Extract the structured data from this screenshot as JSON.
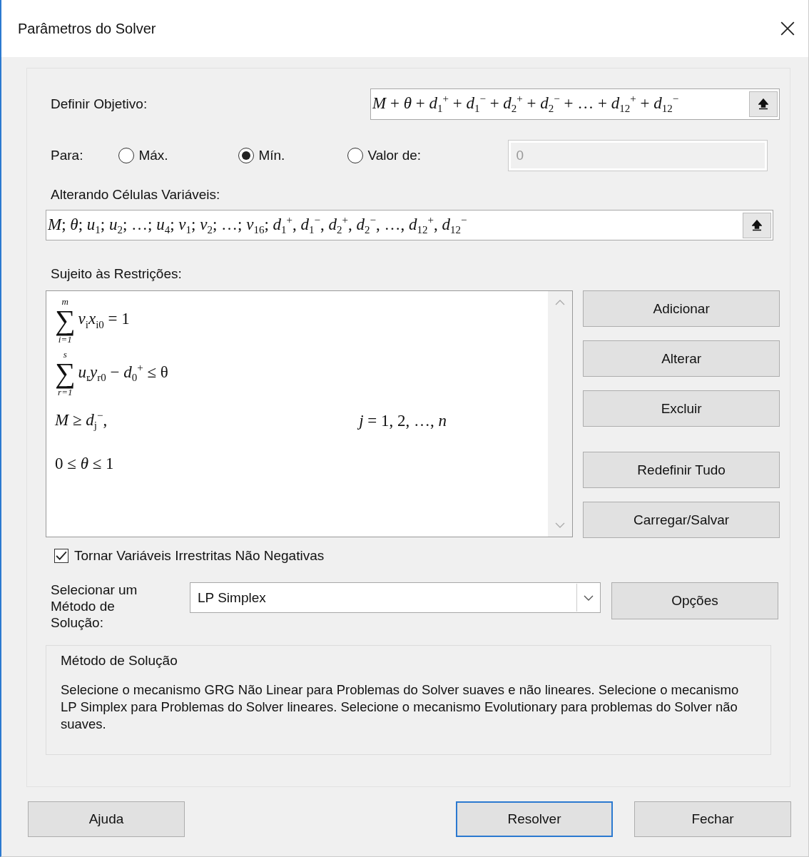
{
  "window": {
    "title": "Parâmetros do Solver"
  },
  "objective": {
    "label": "Definir Objetivo:",
    "value": "*M* + *θ* + *d*$_{1}$$^{+}$ + *d*$_{1}$$^{−}$ + *d*$_{2}$$^{+}$ + *d*$_{2}$$^{−}$ + … + *d*$_{12}$$^{+}$ + *d*$_{12}$$^{−}$"
  },
  "to": {
    "label": "Para:",
    "options": [
      {
        "label": "Máx.",
        "selected": false
      },
      {
        "label": "Mín.",
        "selected": true
      },
      {
        "label": "Valor de:",
        "selected": false
      }
    ],
    "value": "0",
    "disabled": true
  },
  "changing_cells": {
    "label": "Alterando Células Variáveis:",
    "value": "*M*; *θ*; *u*$_{1}$; *u*$_{2}$; …; *u*$_{4}$; *v*$_{1}$; *v*$_{2}$; …; *v*$_{16}$; *d*$_{1}$$^{+}$, *d*$_{1}$$^{−}$, *d*$_{2}$$^{+}$, *d*$_{2}$$^{−}$, …, *d*$_{12}$$^{+}$, *d*$_{12}$$^{−}$"
  },
  "constraints": {
    "label": "Sujeito às Restrições:",
    "items": [
      {
        "kind": "sum",
        "symbol": "∑",
        "upper": "m",
        "lower": "i=1",
        "body": "*v*$_{i}$*x*$_{i0}$ = 1"
      },
      {
        "kind": "sum",
        "symbol": "∑",
        "upper": "s",
        "lower": "r=1",
        "body": "*u*$_{r}$*y*$_{r0}$ − *d*$_{0}$$^{+}$ ≤ θ"
      },
      {
        "kind": "plain",
        "body": "*M* ≥ *d*$_{j}$$^{−}$,",
        "condition": "*j* = 1, 2, …, *n*"
      },
      {
        "kind": "plain",
        "body": "0 ≤ *θ* ≤ 1"
      }
    ]
  },
  "side_buttons": [
    "Adicionar",
    "Alterar",
    "Excluir",
    "Redefinir Tudo",
    "Carregar/Salvar"
  ],
  "nonneg": {
    "label": "Tornar Variáveis Irrestritas Não Negativas",
    "checked": true
  },
  "method": {
    "label": "Selecionar um Método de Solução:",
    "value": "LP Simplex",
    "button": "Opções"
  },
  "description": {
    "title": "Método de Solução",
    "text": "Selecione o mecanismo GRG Não Linear para Problemas do Solver suaves e não lineares. Selecione o mecanismo LP Simplex para Problemas do Solver lineares. Selecione o mecanismo Evolutionary para problemas do Solver não suaves."
  },
  "buttons": [
    {
      "label": "Ajuda",
      "default": false
    },
    {
      "label": "Resolver",
      "default": true
    },
    {
      "label": "Fechar",
      "default": false
    }
  ]
}
